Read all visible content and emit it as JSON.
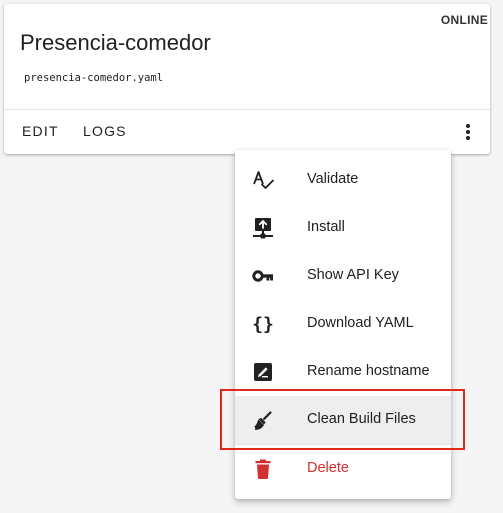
{
  "card": {
    "status": "ONLINE",
    "title": "Presencia-comedor",
    "filename": "presencia-comedor.yaml",
    "actions": {
      "edit": "EDIT",
      "logs": "LOGS"
    }
  },
  "menu": {
    "items": [
      {
        "label": "Validate",
        "icon": "validate-icon"
      },
      {
        "label": "Install",
        "icon": "install-icon"
      },
      {
        "label": "Show API Key",
        "icon": "key-icon"
      },
      {
        "label": "Download YAML",
        "icon": "code-braces-icon"
      },
      {
        "label": "Rename hostname",
        "icon": "rename-icon"
      },
      {
        "label": "Clean Build Files",
        "icon": "broom-icon"
      },
      {
        "label": "Delete",
        "icon": "trash-icon"
      }
    ]
  },
  "colors": {
    "danger": "#d32f2f",
    "highlight_border": "#e0291a",
    "text": "#212121"
  }
}
